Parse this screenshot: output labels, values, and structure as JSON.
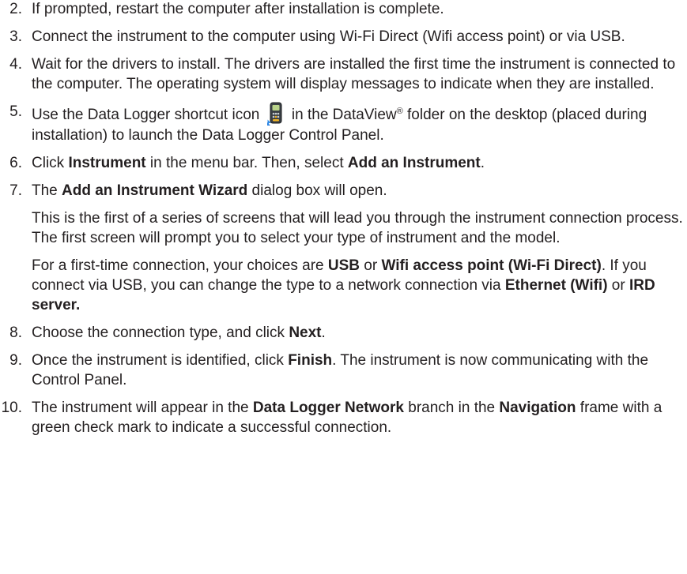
{
  "steps": [
    {
      "num": "2.",
      "text": "If prompted, restart the computer after installation is complete."
    },
    {
      "num": "3.",
      "text": "Connect the instrument to the computer using Wi-Fi Direct (Wifi access point) or via USB."
    },
    {
      "num": "4.",
      "text": "Wait for the drivers to install. The drivers are installed the first time the instrument is connected to the computer. The operating system will display messages to indicate when they are installed."
    },
    {
      "num": "5.",
      "pre": "Use the Data Logger shortcut icon",
      "mid": "in the DataView",
      "reg": "®",
      "post": " folder on the desktop (placed during installation) to launch the Data Logger Control Panel."
    },
    {
      "num": "6.",
      "t1": "Click ",
      "b1": "Instrument",
      "t2": " in the menu bar. Then, select ",
      "b2": "Add an Instrument",
      "t3": "."
    },
    {
      "num": "7.",
      "t1": "The ",
      "b1": "Add an Instrument Wizard",
      "t2": " dialog box will open."
    },
    {
      "num": "8.",
      "t1": "Choose the connection type, and click ",
      "b1": "Next",
      "t2": "."
    },
    {
      "num": "9.",
      "t1": "Once the instrument is identified, click ",
      "b1": "Finish",
      "t2": ". The instrument is now communicating with the Control Panel."
    },
    {
      "num": "10.",
      "t1": "The instrument will appear in the ",
      "b1": "Data Logger Network",
      "t2": " branch in the ",
      "b2": "Navigation",
      "t3": " frame with a green check mark to indicate a successful connection."
    }
  ],
  "step7_para1": "This is the first of a series of screens that will lead you through the instrument connection process. The first screen will prompt you to select your type of instrument and the model.",
  "step7_para2": {
    "t1": "For a first-time connection, your choices are ",
    "b1": "USB",
    "t2": " or ",
    "b2": "Wifi access point (Wi-Fi Direct)",
    "t3": ". If you connect via USB, you can change the type to a network connection via ",
    "b3": "Ethernet (Wifi)",
    "t4": " or ",
    "b4": "IRD server."
  },
  "icon": "data-logger-shortcut-icon"
}
